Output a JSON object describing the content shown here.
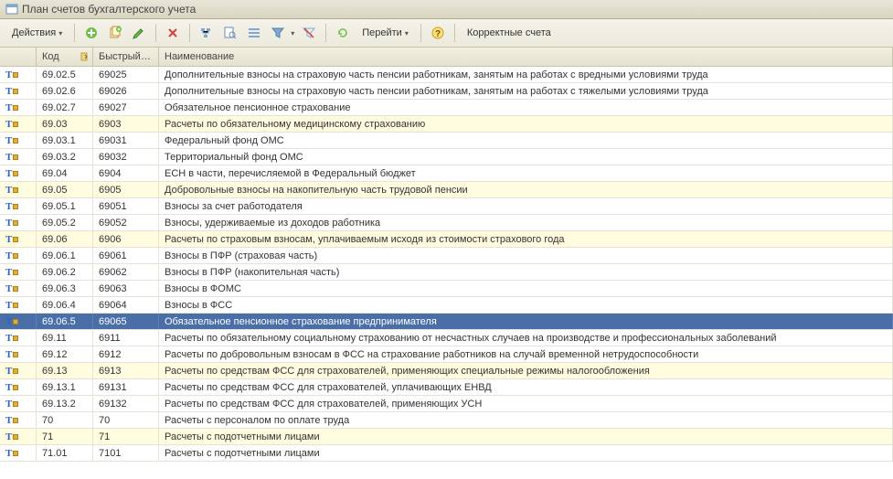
{
  "window": {
    "title": "План счетов бухгалтерского учета"
  },
  "toolbar": {
    "actions_label": "Действия",
    "goto_label": "Перейти",
    "correct_label": "Корректные счета"
  },
  "columns": {
    "code": "Код",
    "quick": "Быстрый…",
    "name": "Наименование"
  },
  "rows": [
    {
      "yellow": false,
      "selected": false,
      "code": "69.02.5",
      "quick": "69025",
      "name": "Дополнительные взносы на страховую часть пенсии работникам, занятым на работах с вредными условиями труда"
    },
    {
      "yellow": false,
      "selected": false,
      "code": "69.02.6",
      "quick": "69026",
      "name": "Дополнительные взносы на страховую часть пенсии работникам, занятым на работах с тяжелыми условиями труда"
    },
    {
      "yellow": false,
      "selected": false,
      "code": "69.02.7",
      "quick": "69027",
      "name": "Обязательное пенсионное страхование"
    },
    {
      "yellow": true,
      "selected": false,
      "code": "69.03",
      "quick": "6903",
      "name": "Расчеты по обязательному медицинскому страхованию"
    },
    {
      "yellow": false,
      "selected": false,
      "code": "69.03.1",
      "quick": "69031",
      "name": "Федеральный фонд ОМС"
    },
    {
      "yellow": false,
      "selected": false,
      "code": "69.03.2",
      "quick": "69032",
      "name": "Территориальный фонд ОМС"
    },
    {
      "yellow": false,
      "selected": false,
      "code": "69.04",
      "quick": "6904",
      "name": "ЕСН в части, перечисляемой в Федеральный бюджет"
    },
    {
      "yellow": true,
      "selected": false,
      "code": "69.05",
      "quick": "6905",
      "name": "Добровольные взносы на накопительную часть трудовой пенсии"
    },
    {
      "yellow": false,
      "selected": false,
      "code": "69.05.1",
      "quick": "69051",
      "name": "Взносы за счет работодателя"
    },
    {
      "yellow": false,
      "selected": false,
      "code": "69.05.2",
      "quick": "69052",
      "name": "Взносы, удерживаемые из доходов работника"
    },
    {
      "yellow": true,
      "selected": false,
      "code": "69.06",
      "quick": "6906",
      "name": "Расчеты по страховым взносам, уплачиваемым исходя из стоимости страхового года"
    },
    {
      "yellow": false,
      "selected": false,
      "code": "69.06.1",
      "quick": "69061",
      "name": "Взносы в ПФР (страховая часть)"
    },
    {
      "yellow": false,
      "selected": false,
      "code": "69.06.2",
      "quick": "69062",
      "name": "Взносы в ПФР (накопительная часть)"
    },
    {
      "yellow": false,
      "selected": false,
      "code": "69.06.3",
      "quick": "69063",
      "name": "Взносы в ФОМС"
    },
    {
      "yellow": false,
      "selected": false,
      "code": "69.06.4",
      "quick": "69064",
      "name": "Взносы в ФСС"
    },
    {
      "yellow": false,
      "selected": true,
      "code": "69.06.5",
      "quick": "69065",
      "name": "Обязательное пенсионное страхование предпринимателя"
    },
    {
      "yellow": false,
      "selected": false,
      "code": "69.11",
      "quick": "6911",
      "name": "Расчеты по обязательному социальному страхованию от несчастных случаев на производстве и профессиональных заболеваний"
    },
    {
      "yellow": false,
      "selected": false,
      "code": "69.12",
      "quick": "6912",
      "name": "Расчеты по добровольным взносам в ФСС на страхование работников на случай временной нетрудоспособности"
    },
    {
      "yellow": true,
      "selected": false,
      "code": "69.13",
      "quick": "6913",
      "name": "Расчеты по средствам ФСС для страхователей, применяющих специальные режимы налогообложения"
    },
    {
      "yellow": false,
      "selected": false,
      "code": "69.13.1",
      "quick": "69131",
      "name": "Расчеты по средствам ФСС для страхователей, уплачивающих ЕНВД"
    },
    {
      "yellow": false,
      "selected": false,
      "code": "69.13.2",
      "quick": "69132",
      "name": "Расчеты по средствам ФСС для страхователей, применяющих УСН"
    },
    {
      "yellow": false,
      "selected": false,
      "code": "70",
      "quick": "70",
      "name": "Расчеты с персоналом по оплате труда"
    },
    {
      "yellow": true,
      "selected": false,
      "code": "71",
      "quick": "71",
      "name": "Расчеты с подотчетными лицами"
    },
    {
      "yellow": false,
      "selected": false,
      "code": "71.01",
      "quick": "7101",
      "name": "Расчеты с подотчетными лицами"
    }
  ]
}
